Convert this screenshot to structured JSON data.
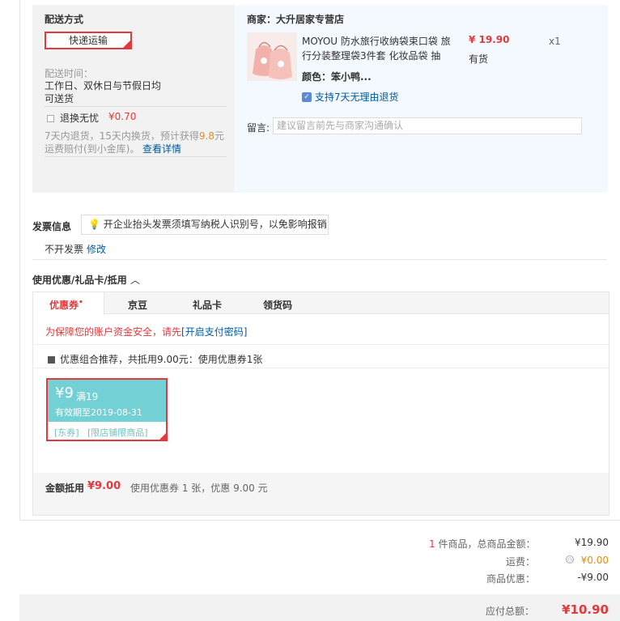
{
  "shipping": {
    "section_title": "配送方式",
    "method_label": "快递运输",
    "time_label": "配送时间：",
    "time_value_line1": "工作日、双休日与节假日均",
    "time_value_line2": "可送货",
    "return_label": "退换无忧",
    "return_price": "¥0.70",
    "return_desc_part1": "7天内退货，15天内换货，预计获得",
    "return_desc_highlight": "9.8",
    "return_desc_part2": "元",
    "return_desc_line2": "运费赔付(到小金库)。",
    "return_detail_link": "查看详情"
  },
  "shop": {
    "seller_label": "商家：大升居家专营店",
    "product_title_line1": "MOYOU 防水旅行收纳袋束口袋 旅",
    "product_title_line2": "行分装整理袋3件套 化妆品袋 抽",
    "price": "¥ 19.90",
    "stock": "有货",
    "quantity": "x1",
    "color_label": "颜色：笨小鸭...",
    "return_policy": "支持7天无理由退货",
    "remark_label": "留言:",
    "remark_placeholder": "建议留言前先与商家沟通确认"
  },
  "invoice": {
    "title": "发票信息",
    "tip": "开企业抬头发票须填写纳税人识别号，以免影响报销",
    "status": "不开发票",
    "edit_link": "修改"
  },
  "discount": {
    "title": "使用优惠/礼品卡/抵用",
    "tabs": [
      {
        "label": "优惠券",
        "active": true,
        "dot": "•"
      },
      {
        "label": "京豆",
        "active": false
      },
      {
        "label": "礼品卡",
        "active": false
      },
      {
        "label": "领货码",
        "active": false
      }
    ],
    "security_notice": "为保障您的账户资金安全，请先",
    "security_link": "[开启支付密码]",
    "combo_recommend": "优惠组合推荐，共抵用9.00元：使用优惠券1张",
    "coupon": {
      "amount": "¥9",
      "threshold": "满19",
      "validity": "有效期至2019-08-31",
      "tag1": "[东券]",
      "tag2": "[限店铺限商品]"
    },
    "summary_label": "金额抵用",
    "summary_amount": "¥9.00",
    "summary_desc": "使用优惠券 1 张，优惠 9.00 元"
  },
  "totals": {
    "item_count": "1",
    "item_count_suffix": "件商品，总商品金额：",
    "item_amount": "¥19.90",
    "shipping_label": "运费：",
    "shipping_amount": "¥0.00",
    "discount_label": "商品优惠：",
    "discount_amount": "-¥9.00",
    "payable_label": "应付总额：",
    "payable_amount": "¥10.90"
  },
  "colors": {
    "accent_red": "#e4393c",
    "link_blue": "#005aa0",
    "coupon_teal": "#73d1d6",
    "shop_panel_bg": "#f3f9fe"
  }
}
